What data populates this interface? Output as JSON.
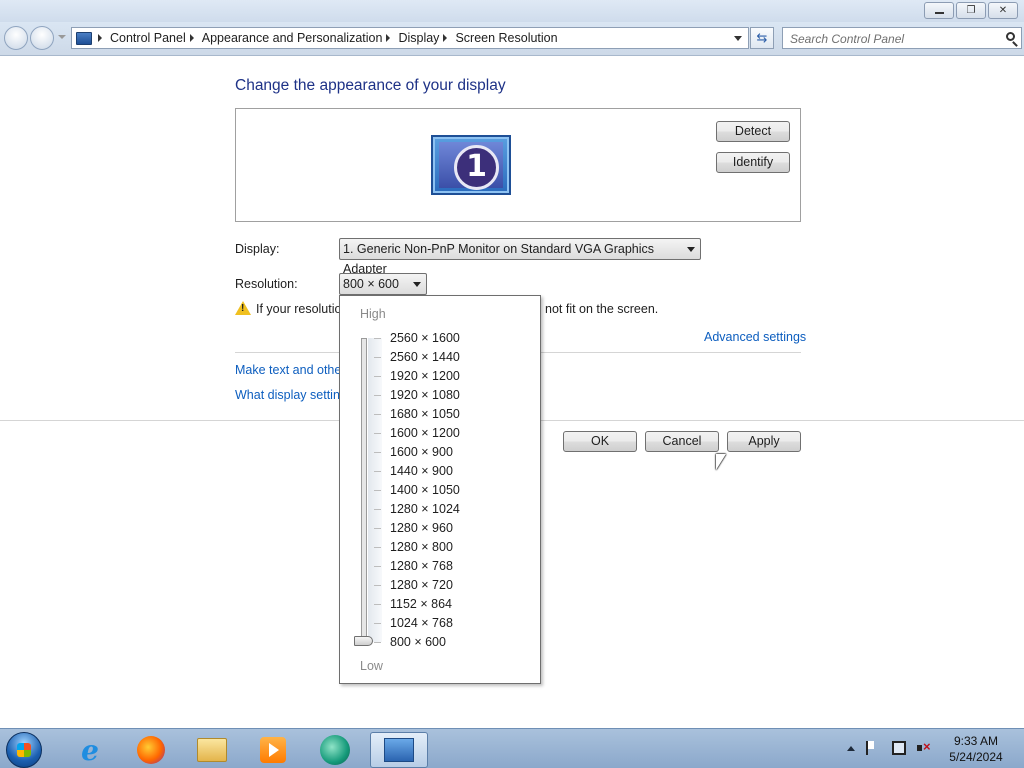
{
  "address_bar": {
    "breadcrumbs": [
      "Control Panel",
      "Appearance and Personalization",
      "Display",
      "Screen Resolution"
    ],
    "search_placeholder": "Search Control Panel"
  },
  "main": {
    "heading": "Change the appearance of your display",
    "monitor_label": "1",
    "detect_label": "Detect",
    "identify_label": "Identify",
    "display_label": "Display:",
    "display_value": "1. Generic Non-PnP Monitor on Standard VGA Graphics Adapter",
    "resolution_label": "Resolution:",
    "resolution_value": "800 × 600",
    "warning_text_start": "If your resolutio",
    "warning_text_end": "not fit on the screen.",
    "advanced_settings": "Advanced settings",
    "link_text_size": "Make text and other",
    "link_what_settings": "What display setting",
    "ok_label": "OK",
    "cancel_label": "Cancel",
    "apply_label": "Apply"
  },
  "resolution_dropdown": {
    "high_label": "High",
    "low_label": "Low",
    "options": [
      "2560 × 1600",
      "2560 × 1440",
      "1920 × 1200",
      "1920 × 1080",
      "1680 × 1050",
      "1600 × 1200",
      "1600 × 900",
      "1440 × 900",
      "1400 × 1050",
      "1280 × 1024",
      "1280 × 960",
      "1280 × 800",
      "1280 × 768",
      "1280 × 720",
      "1152 × 864",
      "1024 × 768",
      "800 × 600"
    ],
    "selected": "800 × 600"
  },
  "taskbar": {
    "apps": [
      "internet-explorer-icon",
      "firefox-icon",
      "file-explorer-icon",
      "media-player-icon",
      "app-icon",
      "control-panel-icon"
    ],
    "time": "9:33 AM",
    "date": "5/24/2024"
  },
  "colors": {
    "heading": "#1e3287",
    "link": "#0d5ebf",
    "taskbar": "#a9c1dc"
  }
}
